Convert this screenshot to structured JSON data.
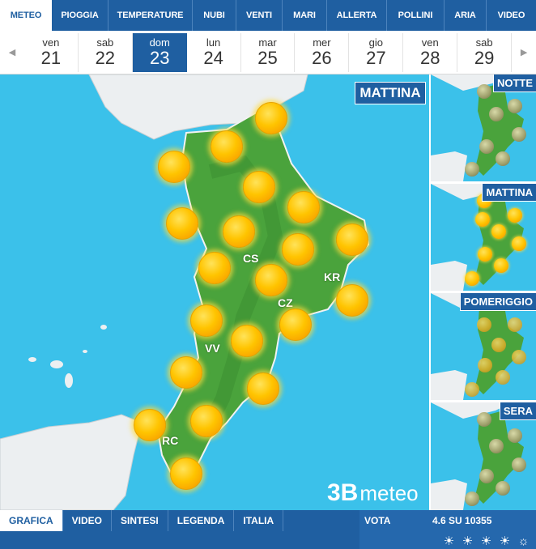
{
  "tabs": [
    "METEO",
    "PIOGGIA",
    "TEMPERATURE",
    "NUBI",
    "VENTI",
    "MARI",
    "ALLERTA",
    "POLLINI",
    "ARIA",
    "VIDEO"
  ],
  "days": [
    {
      "name": "ven",
      "num": "21"
    },
    {
      "name": "sab",
      "num": "22"
    },
    {
      "name": "dom",
      "num": "23"
    },
    {
      "name": "lun",
      "num": "24"
    },
    {
      "name": "mar",
      "num": "25"
    },
    {
      "name": "mer",
      "num": "26"
    },
    {
      "name": "gio",
      "num": "27"
    },
    {
      "name": "ven",
      "num": "28"
    },
    {
      "name": "sab",
      "num": "29"
    }
  ],
  "active_day_index": 2,
  "nav": {
    "prev_icon": "triangle-left-icon",
    "next_icon": "triangle-right-icon"
  },
  "map": {
    "period": "MATTINA",
    "cities": {
      "cs": "CS",
      "kr": "KR",
      "cz": "CZ",
      "vv": "VV",
      "rc": "RC"
    },
    "weather_icon": "sun-icon"
  },
  "side_panels": [
    {
      "label": "NOTTE",
      "icon": "moon-icon"
    },
    {
      "label": "MATTINA",
      "icon": "sun-icon"
    },
    {
      "label": "POMERIGGIO",
      "icon": "sun-icon"
    },
    {
      "label": "SERA",
      "icon": "moon-icon"
    }
  ],
  "logo": {
    "prefix": "3B",
    "suffix": "meteo"
  },
  "bottom_tabs": [
    "GRAFICA",
    "VIDEO",
    "SINTESI",
    "LEGENDA",
    "ITALIA"
  ],
  "vote": {
    "label": "VOTA",
    "score": "4.6 SU 10355",
    "stars": 5
  },
  "colors": {
    "primary": "#1f5fa1",
    "sea": "#3bc1ea",
    "land": "#4aa33c"
  }
}
